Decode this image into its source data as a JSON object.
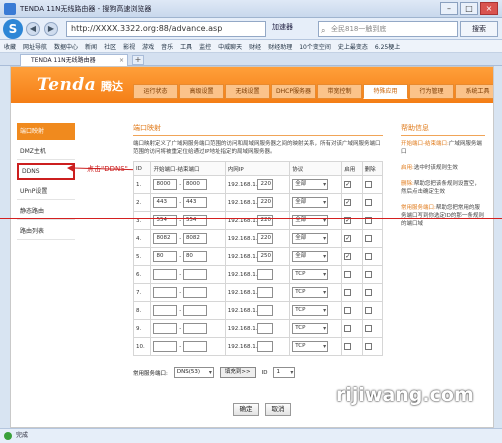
{
  "browser": {
    "window_title": "TENDA 11N无线路由器 - 搜狗高速浏览器",
    "url": "http://XXXX.3322.org:88/advance.asp",
    "accelerate_label": "加速器",
    "search_placeholder": "全民818一触到底",
    "search_button": "搜索",
    "favorites": [
      "收藏",
      "网址导航",
      "数据中心",
      "新闻",
      "社区",
      "影视",
      "游戏",
      "音乐",
      "工具",
      "监控",
      "中威聊天",
      "财经",
      "财经助理",
      "10个变空间",
      "史上最变态",
      "6.25梗上"
    ],
    "tab_label": "TENDA 11N无线路由器",
    "status_text": "完成"
  },
  "router": {
    "brand": "Tenda",
    "brand_cn": "腾达",
    "nav": [
      "运行状态",
      "高级设置",
      "无线设置",
      "DHCP服务器",
      "带宽控制",
      "特殊应用",
      "行为管理",
      "系统工具"
    ],
    "sidebar": [
      "端口映射",
      "DMZ主机",
      "DDNS",
      "UPnP设置",
      "静态路由",
      "路由列表"
    ],
    "annotation": "点击\"DDNS\"",
    "section_title": "端口映射",
    "description": "端口映射定义了广域网服务端口范围的访问和局域网服务器之间的映射关系，所有对该广域网服务端口范围的访问将被重定位给通过IP地址指定的局域网服务器。",
    "table_headers": [
      "ID",
      "开始端口-结束端口",
      "内网IP",
      "协议",
      "启用",
      "删除"
    ],
    "ip_prefix": "192.168.1.",
    "rows": [
      {
        "id": "1.",
        "start": "8000",
        "end": "8000",
        "ip": "220",
        "proto": "全部",
        "enabled": true
      },
      {
        "id": "2.",
        "start": "443",
        "end": "443",
        "ip": "220",
        "proto": "全部",
        "enabled": true
      },
      {
        "id": "3.",
        "start": "554",
        "end": "554",
        "ip": "220",
        "proto": "全部",
        "enabled": true
      },
      {
        "id": "4.",
        "start": "8082",
        "end": "8082",
        "ip": "220",
        "proto": "全部",
        "enabled": true
      },
      {
        "id": "5.",
        "start": "80",
        "end": "80",
        "ip": "250",
        "proto": "全部",
        "enabled": true
      },
      {
        "id": "6.",
        "start": "",
        "end": "",
        "ip": "",
        "proto": "TCP",
        "enabled": false
      },
      {
        "id": "7.",
        "start": "",
        "end": "",
        "ip": "",
        "proto": "TCP",
        "enabled": false
      },
      {
        "id": "8.",
        "start": "",
        "end": "",
        "ip": "",
        "proto": "TCP",
        "enabled": false
      },
      {
        "id": "9.",
        "start": "",
        "end": "",
        "ip": "",
        "proto": "TCP",
        "enabled": false
      },
      {
        "id": "10.",
        "start": "",
        "end": "",
        "ip": "",
        "proto": "TCP",
        "enabled": false
      }
    ],
    "common_label": "常用服务端口:",
    "common_value": "DNS(53)",
    "fill_button": "填充到>>",
    "fill_target_label": "ID",
    "fill_target_value": "1",
    "ok_button": "确定",
    "cancel_button": "取消",
    "help_title": "帮助信息",
    "help": [
      {
        "k": "开始端口-结束端口:",
        "v": "广域网服务端口"
      },
      {
        "k": "启用:",
        "v": "选中时该规则生效"
      },
      {
        "k": "删除:",
        "v": "帮助您把该条规则设置空，然后点击确定生效"
      },
      {
        "k": "常用服务端口:",
        "v": "帮助您把常用的服务端口写到你选定ID的那一条规则的端口域"
      }
    ]
  },
  "watermark": "rijiwang.com",
  "colors": {
    "accent": "#f08a1e",
    "annotation": "#cc1f1f"
  }
}
